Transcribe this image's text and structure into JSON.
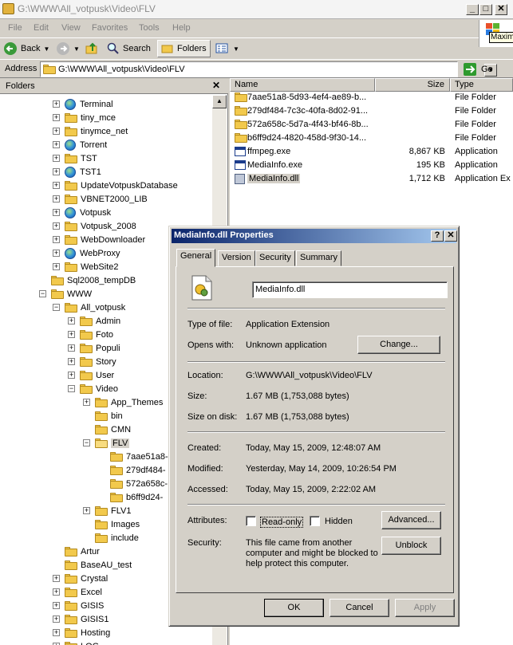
{
  "explorer": {
    "title": "G:\\WWW\\All_votpusk\\Video\\FLV",
    "menu": [
      "File",
      "Edit",
      "View",
      "Favorites",
      "Tools",
      "Help"
    ],
    "toolbar": {
      "back": "Back",
      "search": "Search",
      "folders": "Folders"
    },
    "address_label": "Address",
    "address_value": "G:\\WWW\\All_votpusk\\Video\\FLV",
    "go_label": "Go",
    "tooltip": "Maxim"
  },
  "folders_pane": {
    "title": "Folders",
    "items": [
      {
        "label": "Terminal",
        "icon": "globe"
      },
      {
        "label": "tiny_mce",
        "icon": "folder"
      },
      {
        "label": "tinymce_net",
        "icon": "folder"
      },
      {
        "label": "Torrent",
        "icon": "globe"
      },
      {
        "label": "TST",
        "icon": "folder"
      },
      {
        "label": "TST1",
        "icon": "globe"
      },
      {
        "label": "UpdateVotpuskDatabase",
        "icon": "folder"
      },
      {
        "label": "VBNET2000_LIB",
        "icon": "folder"
      },
      {
        "label": "Votpusk",
        "icon": "globe"
      },
      {
        "label": "Votpusk_2008",
        "icon": "folder"
      },
      {
        "label": "WebDownloader",
        "icon": "folder"
      },
      {
        "label": "WebProxy",
        "icon": "globe"
      },
      {
        "label": "WebSite2",
        "icon": "folder"
      },
      {
        "label": "Sql2008_tempDB",
        "icon": "folder"
      },
      {
        "label": "WWW",
        "icon": "folder"
      },
      {
        "label": "All_votpusk",
        "icon": "folder"
      },
      {
        "label": "Admin",
        "icon": "folder"
      },
      {
        "label": "Foto",
        "icon": "folder"
      },
      {
        "label": "Populi",
        "icon": "folder"
      },
      {
        "label": "Story",
        "icon": "folder"
      },
      {
        "label": "User",
        "icon": "folder"
      },
      {
        "label": "Video",
        "icon": "folder"
      },
      {
        "label": "App_Themes",
        "icon": "folder"
      },
      {
        "label": "bin",
        "icon": "folder"
      },
      {
        "label": "CMN",
        "icon": "folder"
      },
      {
        "label": "FLV",
        "icon": "folder-open"
      },
      {
        "label": "7aae51a8-",
        "icon": "folder"
      },
      {
        "label": "279df484-",
        "icon": "folder"
      },
      {
        "label": "572a658c-",
        "icon": "folder"
      },
      {
        "label": "b6ff9d24-",
        "icon": "folder"
      },
      {
        "label": "FLV1",
        "icon": "folder"
      },
      {
        "label": "Images",
        "icon": "folder"
      },
      {
        "label": "include",
        "icon": "folder"
      },
      {
        "label": "Artur",
        "icon": "folder"
      },
      {
        "label": "BaseAU_test",
        "icon": "folder"
      },
      {
        "label": "Crystal",
        "icon": "folder"
      },
      {
        "label": "Excel",
        "icon": "folder"
      },
      {
        "label": "GISIS",
        "icon": "folder"
      },
      {
        "label": "GISIS1",
        "icon": "folder"
      },
      {
        "label": "Hosting",
        "icon": "folder"
      },
      {
        "label": "LOG",
        "icon": "folder"
      }
    ]
  },
  "file_list": {
    "columns": [
      "Name",
      "Size",
      "Type"
    ],
    "rows": [
      {
        "name": "7aae51a8-5d93-4ef4-ae89-b...",
        "size": "",
        "type": "File Folder",
        "icon": "folder"
      },
      {
        "name": "279df484-7c3c-40fa-8d02-91...",
        "size": "",
        "type": "File Folder",
        "icon": "folder"
      },
      {
        "name": "572a658c-5d7a-4f43-bf46-8b...",
        "size": "",
        "type": "File Folder",
        "icon": "folder"
      },
      {
        "name": "b6ff9d24-4820-458d-9f30-14...",
        "size": "",
        "type": "File Folder",
        "icon": "folder"
      },
      {
        "name": "ffmpeg.exe",
        "size": "8,867 KB",
        "type": "Application",
        "icon": "app"
      },
      {
        "name": "MediaInfo.exe",
        "size": "195 KB",
        "type": "Application",
        "icon": "app"
      },
      {
        "name": "MediaInfo.dll",
        "size": "1,712 KB",
        "type": "Application Ex",
        "icon": "dll"
      }
    ]
  },
  "dialog": {
    "title": "MediaInfo.dll Properties",
    "tabs": [
      "General",
      "Version",
      "Security",
      "Summary"
    ],
    "file_name": "MediaInfo.dll",
    "type_label": "Type of file:",
    "type_value": "Application Extension",
    "opens_label": "Opens with:",
    "opens_value": "Unknown application",
    "change_button": "Change...",
    "location_label": "Location:",
    "location_value": "G:\\WWW\\All_votpusk\\Video\\FLV",
    "size_label": "Size:",
    "size_value": "1.67 MB (1,753,088 bytes)",
    "size_on_disk_label": "Size on disk:",
    "size_on_disk_value": "1.67 MB (1,753,088 bytes)",
    "created_label": "Created:",
    "created_value": "Today, May 15, 2009, 12:48:07 AM",
    "modified_label": "Modified:",
    "modified_value": "Yesterday, May 14, 2009, 10:26:54 PM",
    "accessed_label": "Accessed:",
    "accessed_value": "Today, May 15, 2009, 2:22:02 AM",
    "attributes_label": "Attributes:",
    "readonly_label": "Read-only",
    "hidden_label": "Hidden",
    "advanced_button": "Advanced...",
    "security_label": "Security:",
    "security_text_1": "This file came from another",
    "security_text_2": "computer and might be blocked to",
    "security_text_3": "help protect this computer.",
    "unblock_button": "Unblock",
    "ok_button": "OK",
    "cancel_button": "Cancel",
    "apply_button": "Apply"
  }
}
